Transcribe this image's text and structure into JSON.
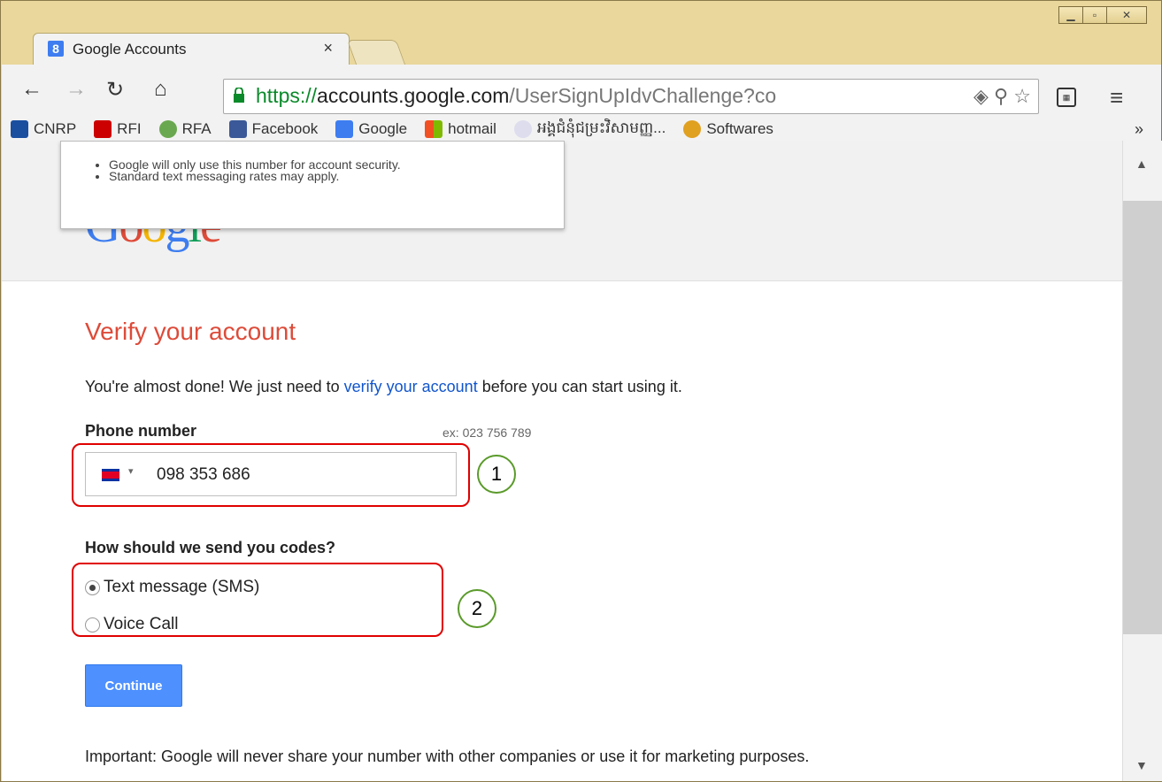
{
  "browser": {
    "tab_title": "Google Accounts",
    "tab_close": "×",
    "url_https": "https://",
    "url_host": "accounts.google.com",
    "url_path": "/UserSignUpIdvChallenge?co",
    "bookmarks": [
      {
        "label": "CNRP",
        "color": "#1a4fa0"
      },
      {
        "label": "RFI",
        "color": "#cc0000"
      },
      {
        "label": "RFA",
        "color": "#6aa84f"
      },
      {
        "label": "Facebook",
        "color": "#3b5998"
      },
      {
        "label": "Google",
        "color": "#3d7df0"
      },
      {
        "label": "hotmail",
        "color": "#f25022"
      },
      {
        "label": "អង្គជំនុំជម្រះវិសាមញ្ញ...",
        "color": "#bcd"
      },
      {
        "label": "Softwares",
        "color": "#e0a020"
      }
    ],
    "bookmarks_more": "»"
  },
  "tooltip": {
    "items": [
      "Google will only use this number for account security.",
      "Standard text messaging rates may apply."
    ]
  },
  "logo_text": "Google",
  "page": {
    "title": "Verify your account",
    "intro_before": "You're almost done! We just need to ",
    "intro_link": "verify your account",
    "intro_after": " before you can start using it.",
    "phone_label": "Phone number",
    "phone_example": "ex: 023 756 789",
    "phone_value": "098 353 686",
    "send_label": "How should we send you codes?",
    "options": [
      {
        "label": "Text message (SMS)",
        "selected": true
      },
      {
        "label": "Voice Call",
        "selected": false
      }
    ],
    "continue_label": "Continue",
    "important": "Important: Google will never share your number with other companies or use it for marketing purposes."
  },
  "annotations": [
    "1",
    "2"
  ],
  "colors": {
    "title_red": "#dd4b39",
    "link_blue": "#1155cc",
    "button_blue": "#4d90fe",
    "annot_red": "#e00000",
    "annot_green": "#5a9a2a"
  }
}
